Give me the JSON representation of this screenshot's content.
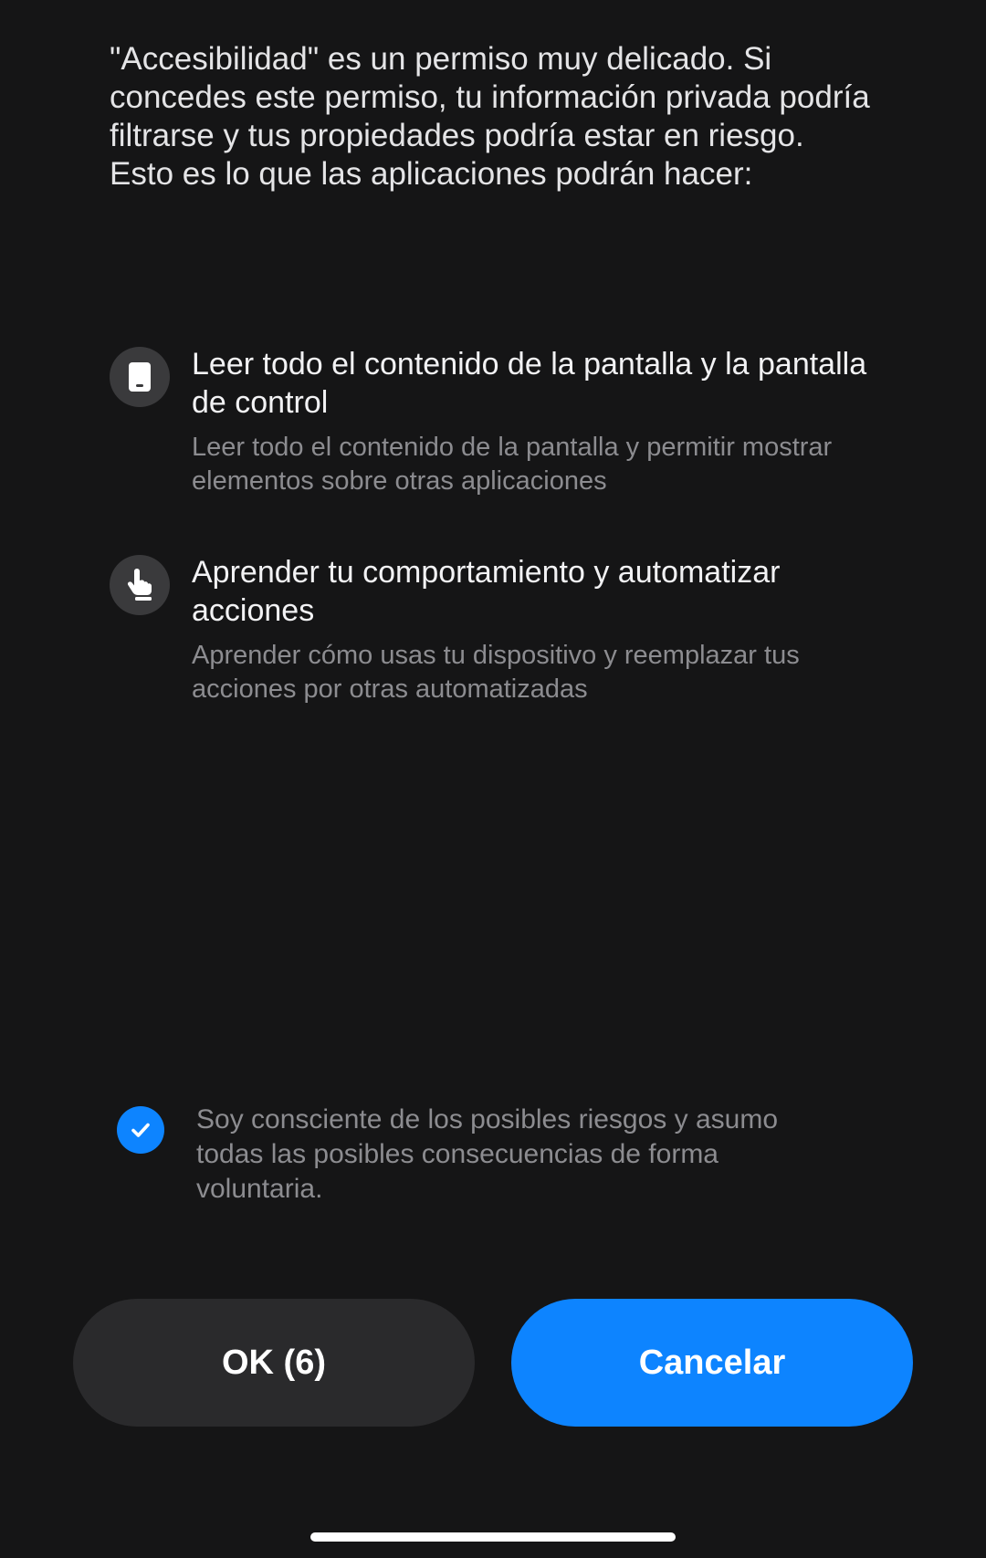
{
  "intro_text": "\"Accesibilidad\" es un permiso muy delicado. Si concedes este permiso, tu información privada podría filtrarse y tus propiedades podría estar en riesgo. Esto es lo que las aplicaciones podrán hacer:",
  "permissions": [
    {
      "icon": "phone-screen-icon",
      "title": "Leer todo el contenido de la pantalla y la pantalla de control",
      "description": "Leer todo el contenido de la pantalla y permitir mostrar elementos sobre otras aplicaciones"
    },
    {
      "icon": "hand-pointer-icon",
      "title": "Aprender tu comportamiento y automatizar acciones",
      "description": "Aprender cómo usas tu dispositivo y reemplazar tus acciones por otras automatizadas"
    }
  ],
  "consent": {
    "checked": true,
    "text": "Soy consciente de los posibles riesgos y asumo todas las posibles consecuencias de forma voluntaria."
  },
  "buttons": {
    "ok_label": "OK (6)",
    "cancel_label": "Cancelar"
  },
  "colors": {
    "background": "#151516",
    "accent": "#0d84ff",
    "secondary_button": "#2a2a2c",
    "muted_text": "#8c8c90"
  }
}
